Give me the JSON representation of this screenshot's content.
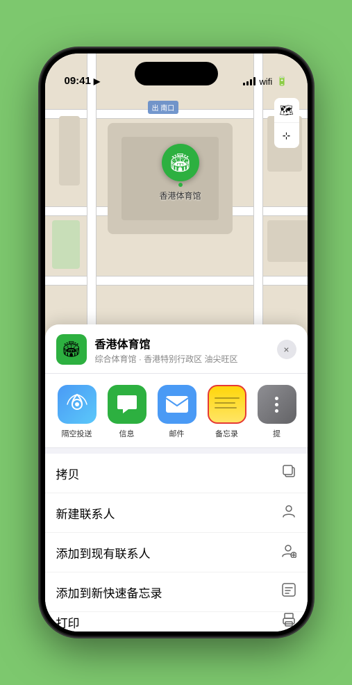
{
  "status": {
    "time": "09:41",
    "location_icon": "▶"
  },
  "map": {
    "label_nankou": "南口",
    "label_nankou_prefix": "出",
    "pin_label": "香港体育馆",
    "map_icon": "🗺",
    "location_icon": "⊹"
  },
  "sheet": {
    "icon": "🏟",
    "title": "香港体育馆",
    "subtitle": "综合体育馆 · 香港特别行政区 油尖旺区",
    "close_label": "×"
  },
  "share_items": [
    {
      "id": "airdrop",
      "label": "隔空投送",
      "icon": "📡"
    },
    {
      "id": "messages",
      "label": "信息",
      "icon": "💬"
    },
    {
      "id": "mail",
      "label": "邮件",
      "icon": "✉"
    },
    {
      "id": "notes",
      "label": "备忘录",
      "icon": ""
    },
    {
      "id": "more",
      "label": "提",
      "icon": ""
    }
  ],
  "actions": [
    {
      "id": "copy",
      "label": "拷贝",
      "icon": "⊡"
    },
    {
      "id": "new-contact",
      "label": "新建联系人",
      "icon": "👤"
    },
    {
      "id": "add-existing",
      "label": "添加到现有联系人",
      "icon": "👤"
    },
    {
      "id": "add-notes",
      "label": "添加到新快速备忘录",
      "icon": "▦"
    },
    {
      "id": "print",
      "label": "打印",
      "icon": "🖨"
    }
  ]
}
